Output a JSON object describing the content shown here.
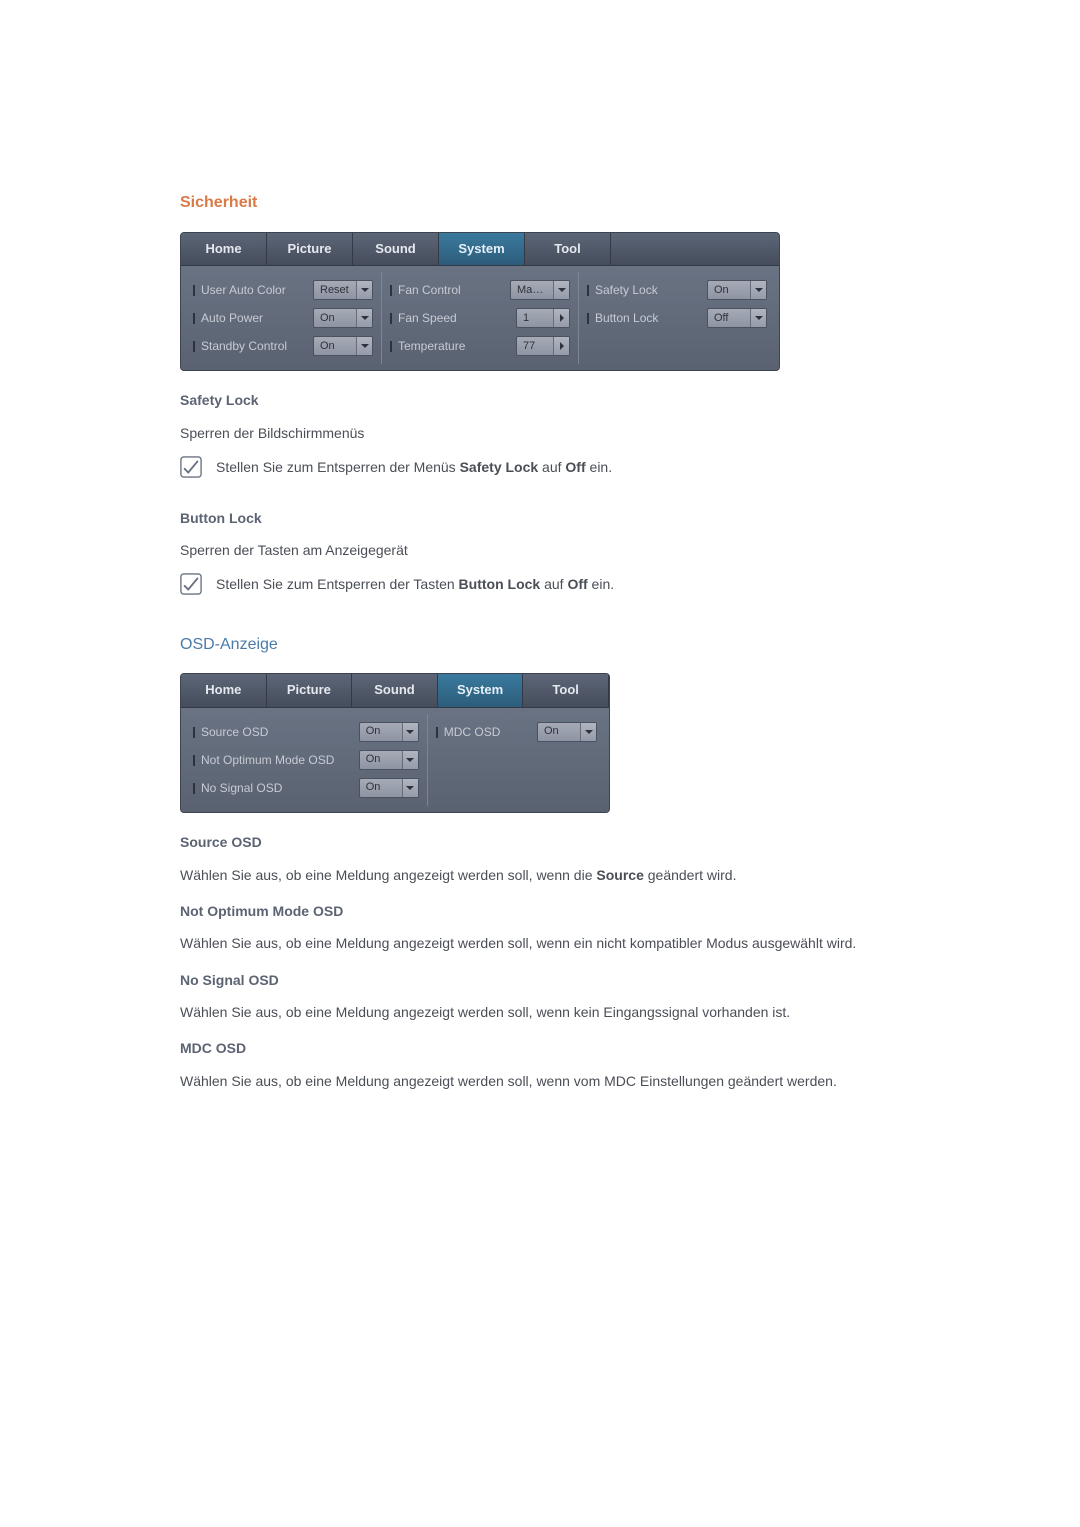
{
  "section1": {
    "title": "Sicherheit",
    "tabs": [
      "Home",
      "Picture",
      "Sound",
      "System",
      "Tool"
    ],
    "active_tab_index": 3,
    "col1": [
      {
        "label": "User Auto Color",
        "value": "Reset",
        "type": "dropdown"
      },
      {
        "label": "Auto Power",
        "value": "On",
        "type": "dropdown"
      },
      {
        "label": "Standby Control",
        "value": "On",
        "type": "dropdown"
      }
    ],
    "col2": [
      {
        "label": "Fan Control",
        "value": "Man...",
        "type": "dropdown"
      },
      {
        "label": "Fan Speed",
        "value": "1",
        "type": "spinner"
      },
      {
        "label": "Temperature",
        "value": "77",
        "type": "spinner"
      }
    ],
    "col3": [
      {
        "label": "Safety Lock",
        "value": "On",
        "type": "dropdown"
      },
      {
        "label": "Button Lock",
        "value": "Off",
        "type": "dropdown"
      }
    ],
    "safety_lock": {
      "heading": "Safety Lock",
      "body": "Sperren der Bildschirmmenüs",
      "note_pre": "Stellen Sie zum Entsperren der Menüs ",
      "note_bold": "Safety Lock",
      "note_mid": " auf ",
      "note_bold2": "Off",
      "note_post": " ein."
    },
    "button_lock": {
      "heading": "Button Lock",
      "body": "Sperren der Tasten am Anzeigegerät",
      "note_pre": "Stellen Sie zum Entsperren der Tasten ",
      "note_bold": "Button Lock",
      "note_mid": " auf ",
      "note_bold2": "Off",
      "note_post": " ein."
    }
  },
  "section2": {
    "title": "OSD-Anzeige",
    "tabs": [
      "Home",
      "Picture",
      "Sound",
      "System",
      "Tool"
    ],
    "active_tab_index": 3,
    "col1": [
      {
        "label": "Source OSD",
        "value": "On"
      },
      {
        "label": "Not Optimum Mode OSD",
        "value": "On"
      },
      {
        "label": "No Signal OSD",
        "value": "On"
      }
    ],
    "col2": [
      {
        "label": "MDC OSD",
        "value": "On"
      }
    ],
    "items": [
      {
        "heading": "Source OSD",
        "body_pre": "Wählen Sie aus, ob eine Meldung angezeigt werden soll, wenn die ",
        "body_bold": "Source",
        "body_post": " geändert wird."
      },
      {
        "heading": "Not Optimum Mode OSD",
        "body_pre": "Wählen Sie aus, ob eine Meldung angezeigt werden soll, wenn ein nicht kompatibler Modus ausgewählt wird.",
        "body_bold": "",
        "body_post": ""
      },
      {
        "heading": "No Signal OSD",
        "body_pre": "Wählen Sie aus, ob eine Meldung angezeigt werden soll, wenn kein Eingangssignal vorhanden ist.",
        "body_bold": "",
        "body_post": ""
      },
      {
        "heading": "MDC OSD",
        "body_pre": "Wählen Sie aus, ob eine Meldung angezeigt werden soll, wenn vom MDC Einstellungen geändert werden.",
        "body_bold": "",
        "body_post": ""
      }
    ]
  }
}
